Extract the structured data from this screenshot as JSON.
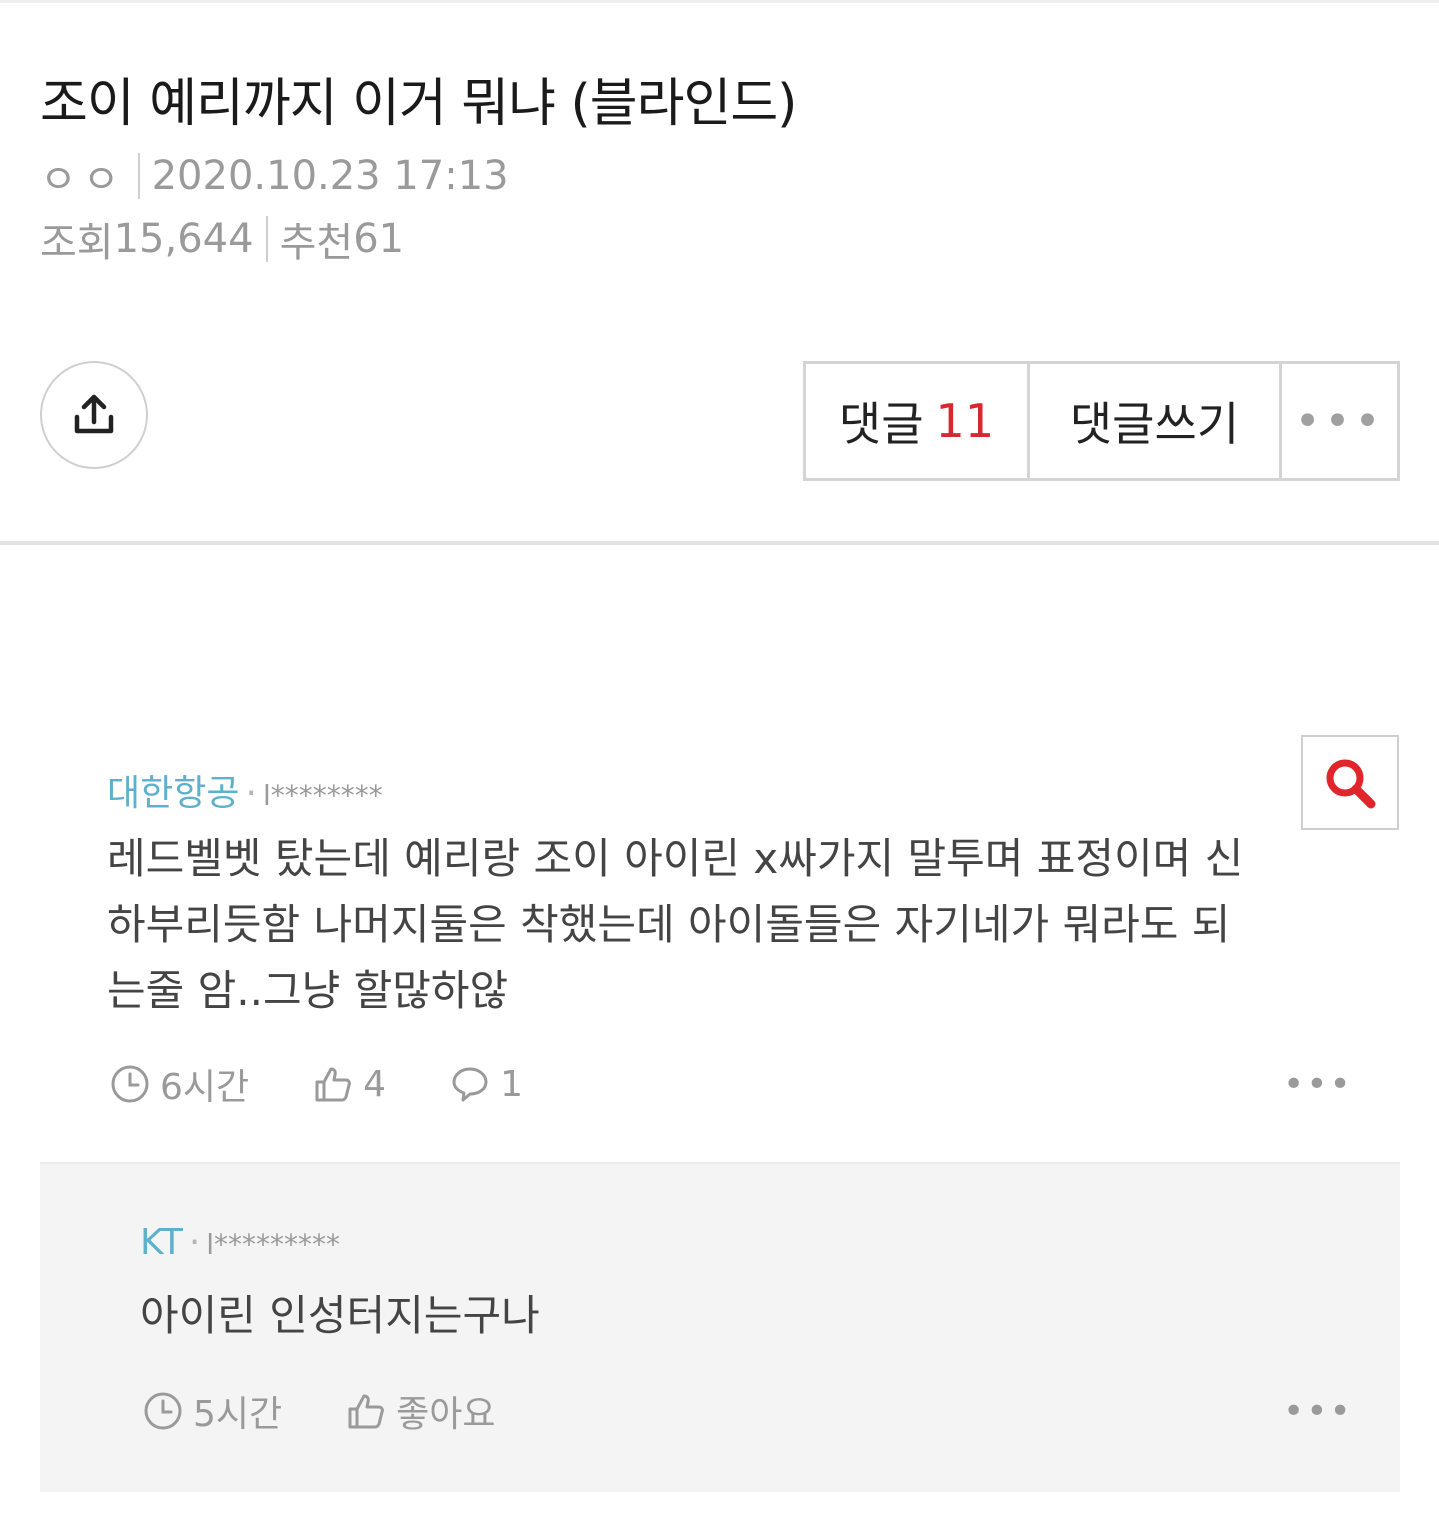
{
  "post": {
    "title": "조이 예리까지 이거 뭐냐 (블라인드)",
    "author": "ㅇㅇ",
    "datetime": "2020.10.23 17:13",
    "views_label": "조회",
    "views": "15,644",
    "recommend_label": "추천",
    "recommend": "61"
  },
  "toolbar": {
    "comments_label": "댓글",
    "comments_count": "11",
    "write_label": "댓글쓰기",
    "more_label": "•••"
  },
  "comments": [
    {
      "company": "대한항공",
      "masked_id": "l********",
      "body_lines": [
        "레드벨벳 탔는데 예리랑 조이 아이린 x싸가지 말투며 표정이며 신",
        "하부리듯함 나머지둘은 착했는데 아이돌들은 자기네가 뭐라도 되",
        "는줄 암..그냥 할많하않"
      ],
      "time": "6시간",
      "likes": "4",
      "replies": "1",
      "more": "•••"
    },
    {
      "company": "KT",
      "masked_id": "l*********",
      "body_lines": [
        "아이린 인성터지는구나"
      ],
      "time": "5시간",
      "likes": "좋아요",
      "more": "•••"
    }
  ],
  "colors": {
    "accent_red": "#d7282f",
    "company_blue": "#5fb0cc",
    "search_red": "#e0252b"
  }
}
